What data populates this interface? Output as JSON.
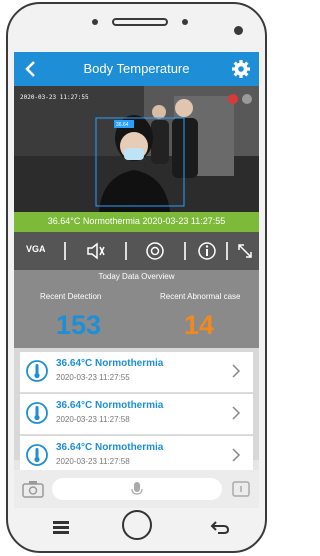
{
  "header": {
    "title": "Body Temperature"
  },
  "video": {
    "timestamp": "2020-03-23 11:27:55"
  },
  "status_bar": {
    "text": "36.64°C Normothermia 2020-03-23 11:27:55"
  },
  "toolbar": {
    "resolution_label": "VGA"
  },
  "overview": {
    "title": "Today Data Overview",
    "recent_detection_label": "Recent Detection",
    "recent_detection_value": "153",
    "recent_abnormal_label": "Recent Abnormal case",
    "recent_abnormal_value": "14",
    "colors": {
      "detection": "#1e8fd6",
      "abnormal": "#f08a1c"
    }
  },
  "records": [
    {
      "reading": "36.64°C Normothermia",
      "time": "2020-03-23 11:27:55"
    },
    {
      "reading": "36.64°C Normothermia",
      "time": "2020-03-23 11:27:58"
    },
    {
      "reading": "36.64°C Normothermia",
      "time": "2020-03-23 11:27:58"
    }
  ],
  "icons": {
    "back": "back-arrow-icon",
    "settings": "gear-icon",
    "mute": "speaker-mute-icon",
    "capture": "snapshot-icon",
    "info": "info-icon",
    "fullscreen": "expand-icon",
    "record_item": "thermometer-icon",
    "chevron": "chevron-right-icon",
    "camera": "camera-icon",
    "mic": "microphone-icon"
  }
}
